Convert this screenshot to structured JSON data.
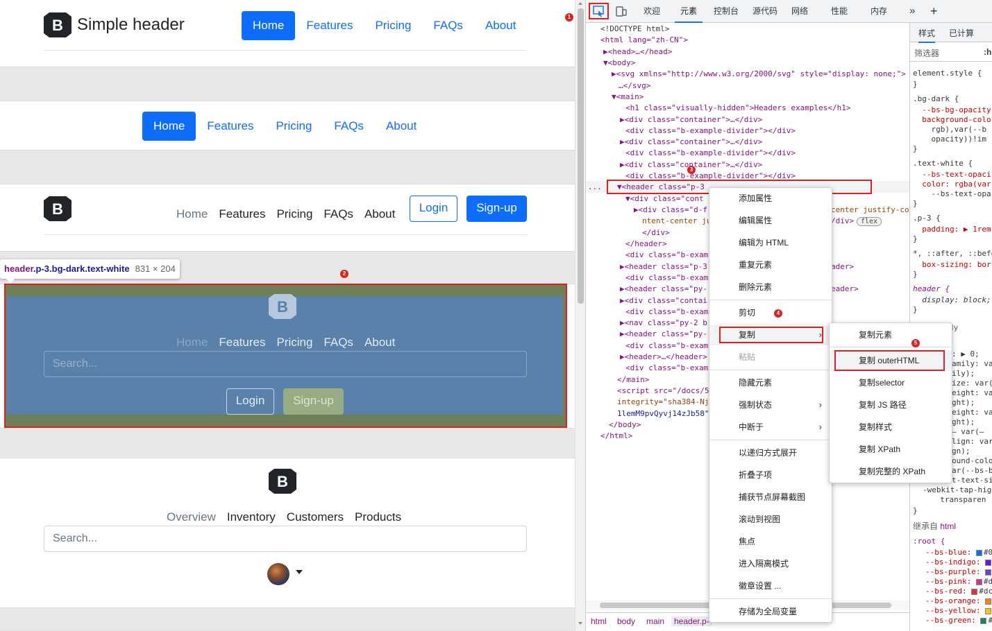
{
  "preview": {
    "header1": {
      "brand": "Simple header",
      "nav": [
        "Home",
        "Features",
        "Pricing",
        "FAQs",
        "About"
      ]
    },
    "header2": {
      "nav": [
        "Home",
        "Features",
        "Pricing",
        "FAQs",
        "About"
      ]
    },
    "header3": {
      "nav": [
        "Home",
        "Features",
        "Pricing",
        "FAQs",
        "About"
      ],
      "login": "Login",
      "signup": "Sign-up"
    },
    "header4": {
      "nav": [
        "Home",
        "Features",
        "Pricing",
        "FAQs",
        "About"
      ],
      "search_placeholder": "Search...",
      "login": "Login",
      "signup": "Sign-up"
    },
    "header5": {
      "nav": [
        "Overview",
        "Inventory",
        "Customers",
        "Products"
      ],
      "search_placeholder": "Search..."
    },
    "tooltip": {
      "tag": "header",
      "classes": ".p-3.bg-dark.text-white",
      "size": "831 × 204"
    },
    "badges": [
      "1",
      "2",
      "3",
      "4",
      "5"
    ]
  },
  "devtools": {
    "tabs": [
      "欢迎",
      "元素",
      "控制台",
      "源代码",
      "网络",
      "性能",
      "内存"
    ],
    "active_tab": "元素",
    "more": "»",
    "add": "+",
    "dom_lines": [
      "<!DOCTYPE html>",
      "<html lang=\"zh-CN\">",
      "▶<head>…</head>",
      "▼<body>",
      "▶<svg xmlns=\"http://www.w3.org/2000/svg\" style=\"display: none;\">",
      "…</svg>",
      "▼<main>",
      "<h1 class=\"visually-hidden\">Headers examples</h1>",
      "▶<div class=\"container\">…</div>",
      "<div class=\"b-example-divider\"></div>",
      "▶<div class=\"container\">…</div>",
      "<div class=\"b-example-divider\"></div>",
      "▶<div class=\"container\">…</div>",
      "<div class=\"b-example-divider\"></div>",
      "▼<header class=\"p-3",
      "▼<div class=\"cont",
      "▶<div class=\"d-f",
      "ntent-center ju",
      "</div>",
      "</header>",
      "<div class=\"b-exam",
      "▶<header class=\"p-3",
      "<div class=\"b-exam",
      "▶<header class=\"py-",
      "▶<div class=\"contai",
      "<div class=\"b-exam",
      "▶<nav class=\"py-2 b",
      "▶<header class=\"py-",
      "<div class=\"b-exam",
      "▶<header>…</header>",
      "<div class=\"b-exam",
      "</main>",
      "<script src=\"/docs/5",
      "integrity=\"sha384-Nj",
      "1lemM9pvQyvj14zJb58\"",
      "</body>",
      "</html>"
    ],
    "dom_right_fragments": [
      "center justify-co",
      "/div>",
      "flex",
      "ader>",
      "eader>"
    ],
    "ellipsis": "...",
    "breadcrumbs": [
      "html",
      "body",
      "main",
      "header.p-"
    ],
    "styles": {
      "tabs": [
        "样式",
        "已计算"
      ],
      "filter": "筛选器",
      "filter_hint": ":h",
      "lines": [
        "element.style {",
        "}",
        ".bg-dark {",
        "  --bs-bg-opacity",
        "  background-colo",
        "    rgb),var(--b",
        "    opacity))!im",
        "}",
        ".text-white {",
        "  --bs-text-opaci",
        "  color: rgba(var",
        "    --bs-text-opa",
        "}",
        ".p-3 {",
        "  padding: ▶ 1rem",
        "}",
        "*, ::after, ::befo",
        "  box-sizing: bor",
        "}",
        "header {",
        "  display: block;",
        "}"
      ],
      "lower_lines": [
        "dy",
        ": ▶ 0;",
        "amily: va",
        "ily);",
        "ize: var(",
        "eight: va",
        "ght);",
        "eight: va",
        "ght);",
        "— var(—",
        "lign: var",
        "gn);",
        "ound-colo",
        "ar(--bs-b",
        "t-text-si",
        "-webkit-tap-hig",
        "  transparen",
        "}"
      ],
      "inherited_label": "继承自",
      "inherited_tag": "html",
      "root": ":root {",
      "vars": [
        {
          "name": "--bs-blue:",
          "color": "#0d6efd",
          "text": "#0"
        },
        {
          "name": "--bs-indigo:",
          "color": "#6610f2",
          "text": ""
        },
        {
          "name": "--bs-purple:",
          "color": "#6f42c1",
          "text": ""
        },
        {
          "name": "--bs-pink:",
          "color": "#d63384",
          "text": "#d"
        },
        {
          "name": "--bs-red:",
          "color": "#dc3545",
          "text": "#dc"
        },
        {
          "name": "--bs-orange:",
          "color": "#fd7e14",
          "text": ""
        },
        {
          "name": "--bs-yellow:",
          "color": "#ffc107",
          "text": ""
        },
        {
          "name": "--bs-green:",
          "color": "#198754",
          "text": "#"
        }
      ]
    },
    "context_menu": [
      "添加属性",
      "编辑属性",
      "编辑为 HTML",
      "重复元素",
      "删除元素",
      "剪切",
      "复制",
      "粘贴",
      "隐藏元素",
      "强制状态",
      "中断于",
      "以递归方式展开",
      "折叠子项",
      "捕获节点屏幕截图",
      "滚动到视图",
      "焦点",
      "进入隔离模式",
      "徽章设置 ...",
      "存储为全局变量"
    ],
    "submenu": [
      "复制元素",
      "复制 outerHTML",
      "复制selector",
      "复制 JS 路径",
      "复制样式",
      "复制 XPath",
      "复制完整的 XPath"
    ]
  },
  "colors": {
    "accent": "#0d6efd",
    "highlight_red": "#e02020",
    "overlay_blue": "#5a81aa",
    "overlay_green": "#6f7f58"
  }
}
